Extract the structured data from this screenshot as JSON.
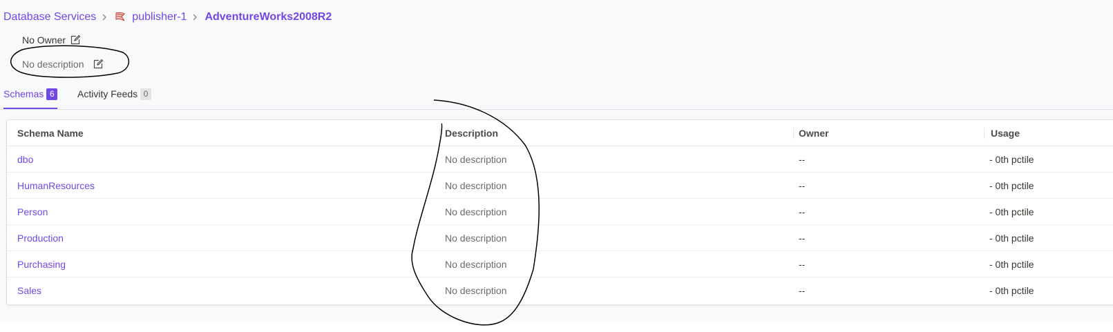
{
  "breadcrumb": {
    "root": "Database Services",
    "service": "publisher-1",
    "service_icon": "mssql-icon",
    "current": "AdventureWorks2008R2"
  },
  "owner": {
    "label": "No Owner",
    "edit_icon": "edit-icon"
  },
  "description": {
    "label": "No description",
    "edit_icon": "edit-icon"
  },
  "tabs": [
    {
      "label": "Schemas",
      "count": "6",
      "active": true
    },
    {
      "label": "Activity Feeds",
      "count": "0",
      "active": false
    }
  ],
  "table": {
    "columns": [
      "Schema Name",
      "Description",
      "Owner",
      "Usage"
    ],
    "rows": [
      {
        "name": "dbo",
        "description": "No description",
        "owner": "--",
        "usage": "- 0th pctile"
      },
      {
        "name": "HumanResources",
        "description": "No description",
        "owner": "--",
        "usage": "- 0th pctile"
      },
      {
        "name": "Person",
        "description": "No description",
        "owner": "--",
        "usage": "- 0th pctile"
      },
      {
        "name": "Production",
        "description": "No description",
        "owner": "--",
        "usage": "- 0th pctile"
      },
      {
        "name": "Purchasing",
        "description": "No description",
        "owner": "--",
        "usage": "- 0th pctile"
      },
      {
        "name": "Sales",
        "description": "No description",
        "owner": "--",
        "usage": "- 0th pctile"
      }
    ]
  },
  "colors": {
    "accent": "#7147e8",
    "muted_text": "#6b6b6b",
    "annotation_ink": "#000000"
  }
}
